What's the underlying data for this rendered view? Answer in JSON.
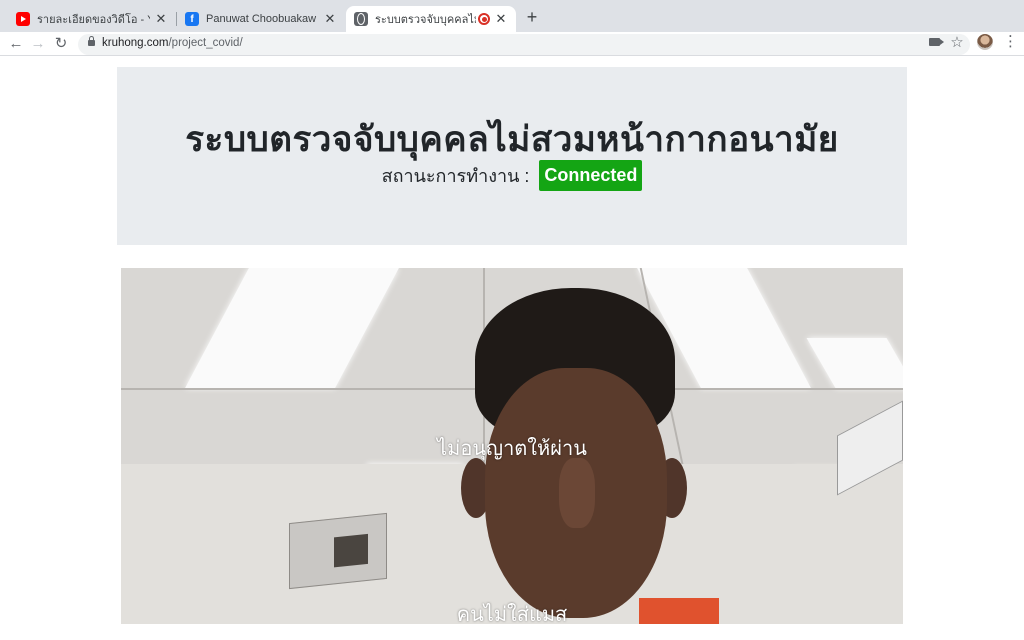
{
  "browser": {
    "tabs": [
      {
        "title": "รายละเอียดของวิดีโอ - YouTube St",
        "icon": "youtube-icon",
        "active": false
      },
      {
        "title": "Panuwat Choobuakaw | Facebo",
        "icon": "facebook-icon",
        "active": false
      },
      {
        "title": "ระบบตรวจจับบุคคลไม่สวมหน้า",
        "icon": "globe-icon",
        "active": true
      }
    ],
    "new_tab_label": "+",
    "close_label": "✕",
    "url_host": "kruhong.com",
    "url_path": "/project_covid/"
  },
  "header": {
    "title": "ระบบตรวจจับบุคคลไม่สวมหน้ากากอนามัย",
    "status_label": "สถานะการทำงาน :",
    "status_value": "Connected",
    "status_color": "#14a514"
  },
  "camera": {
    "label_top": "ไม่อนุญาตให้ผ่าน",
    "label_bottom": "คนไม่ใส่แมส"
  }
}
